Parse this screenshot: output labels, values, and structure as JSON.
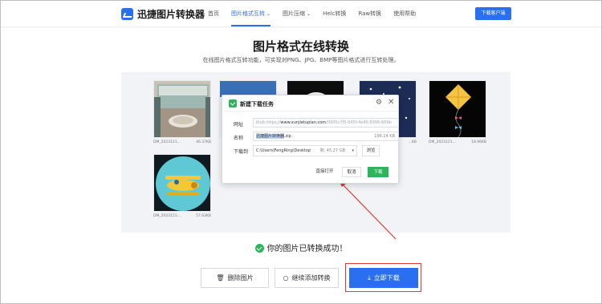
{
  "header": {
    "logo_text": "迅捷图片转换器",
    "nav": [
      {
        "label": "首页"
      },
      {
        "label": "图片格式互转"
      },
      {
        "label": "图片压缩"
      },
      {
        "label": "Heic转换"
      },
      {
        "label": "Raw转换"
      },
      {
        "label": "使用帮助"
      }
    ],
    "download_client": "下载客户端"
  },
  "main": {
    "title": "图片格式在线转换",
    "subtitle": "在线图片格式互转功能，可实现对PNG、JPG、BMP等图片格式进行互转处理。"
  },
  "images": [
    {
      "name": "DM_2023121...",
      "size": "46.37KB"
    },
    {
      "name": "",
      "size": ""
    },
    {
      "name": "",
      "size": ""
    },
    {
      "name": "",
      "size": "...KB"
    },
    {
      "name": "DM_2023121...",
      "size": "18.96KB"
    },
    {
      "name": "DM_2023121...",
      "size": "57.63KB"
    }
  ],
  "dialog": {
    "title": "新建下载任务",
    "url_label": "网址",
    "url_prefix": "blob:https://",
    "url_host": "www.xunjietupian.com",
    "url_rest": "/0905c7f5-045f-4e40-9366-669b",
    "name_label": "名称",
    "file_base": "迅捷图片转换器",
    "file_ext": ".zip",
    "file_size": "196.14 KB",
    "path_label": "下载到",
    "path": "C:\\Users\\FengRing\\Desktop",
    "free_space": "剩: 45.27 GB",
    "browse": "浏览",
    "open_directly": "直接打开",
    "cancel": "取消",
    "download": "下载"
  },
  "result": {
    "success_text": "你的图片已转换成功！",
    "delete": "删除图片",
    "add_more": "继续添加转换",
    "download_now": "立即下载"
  },
  "colors": {
    "accent": "#2a6ff0",
    "success": "#2db55d",
    "highlight": "#e53935"
  }
}
